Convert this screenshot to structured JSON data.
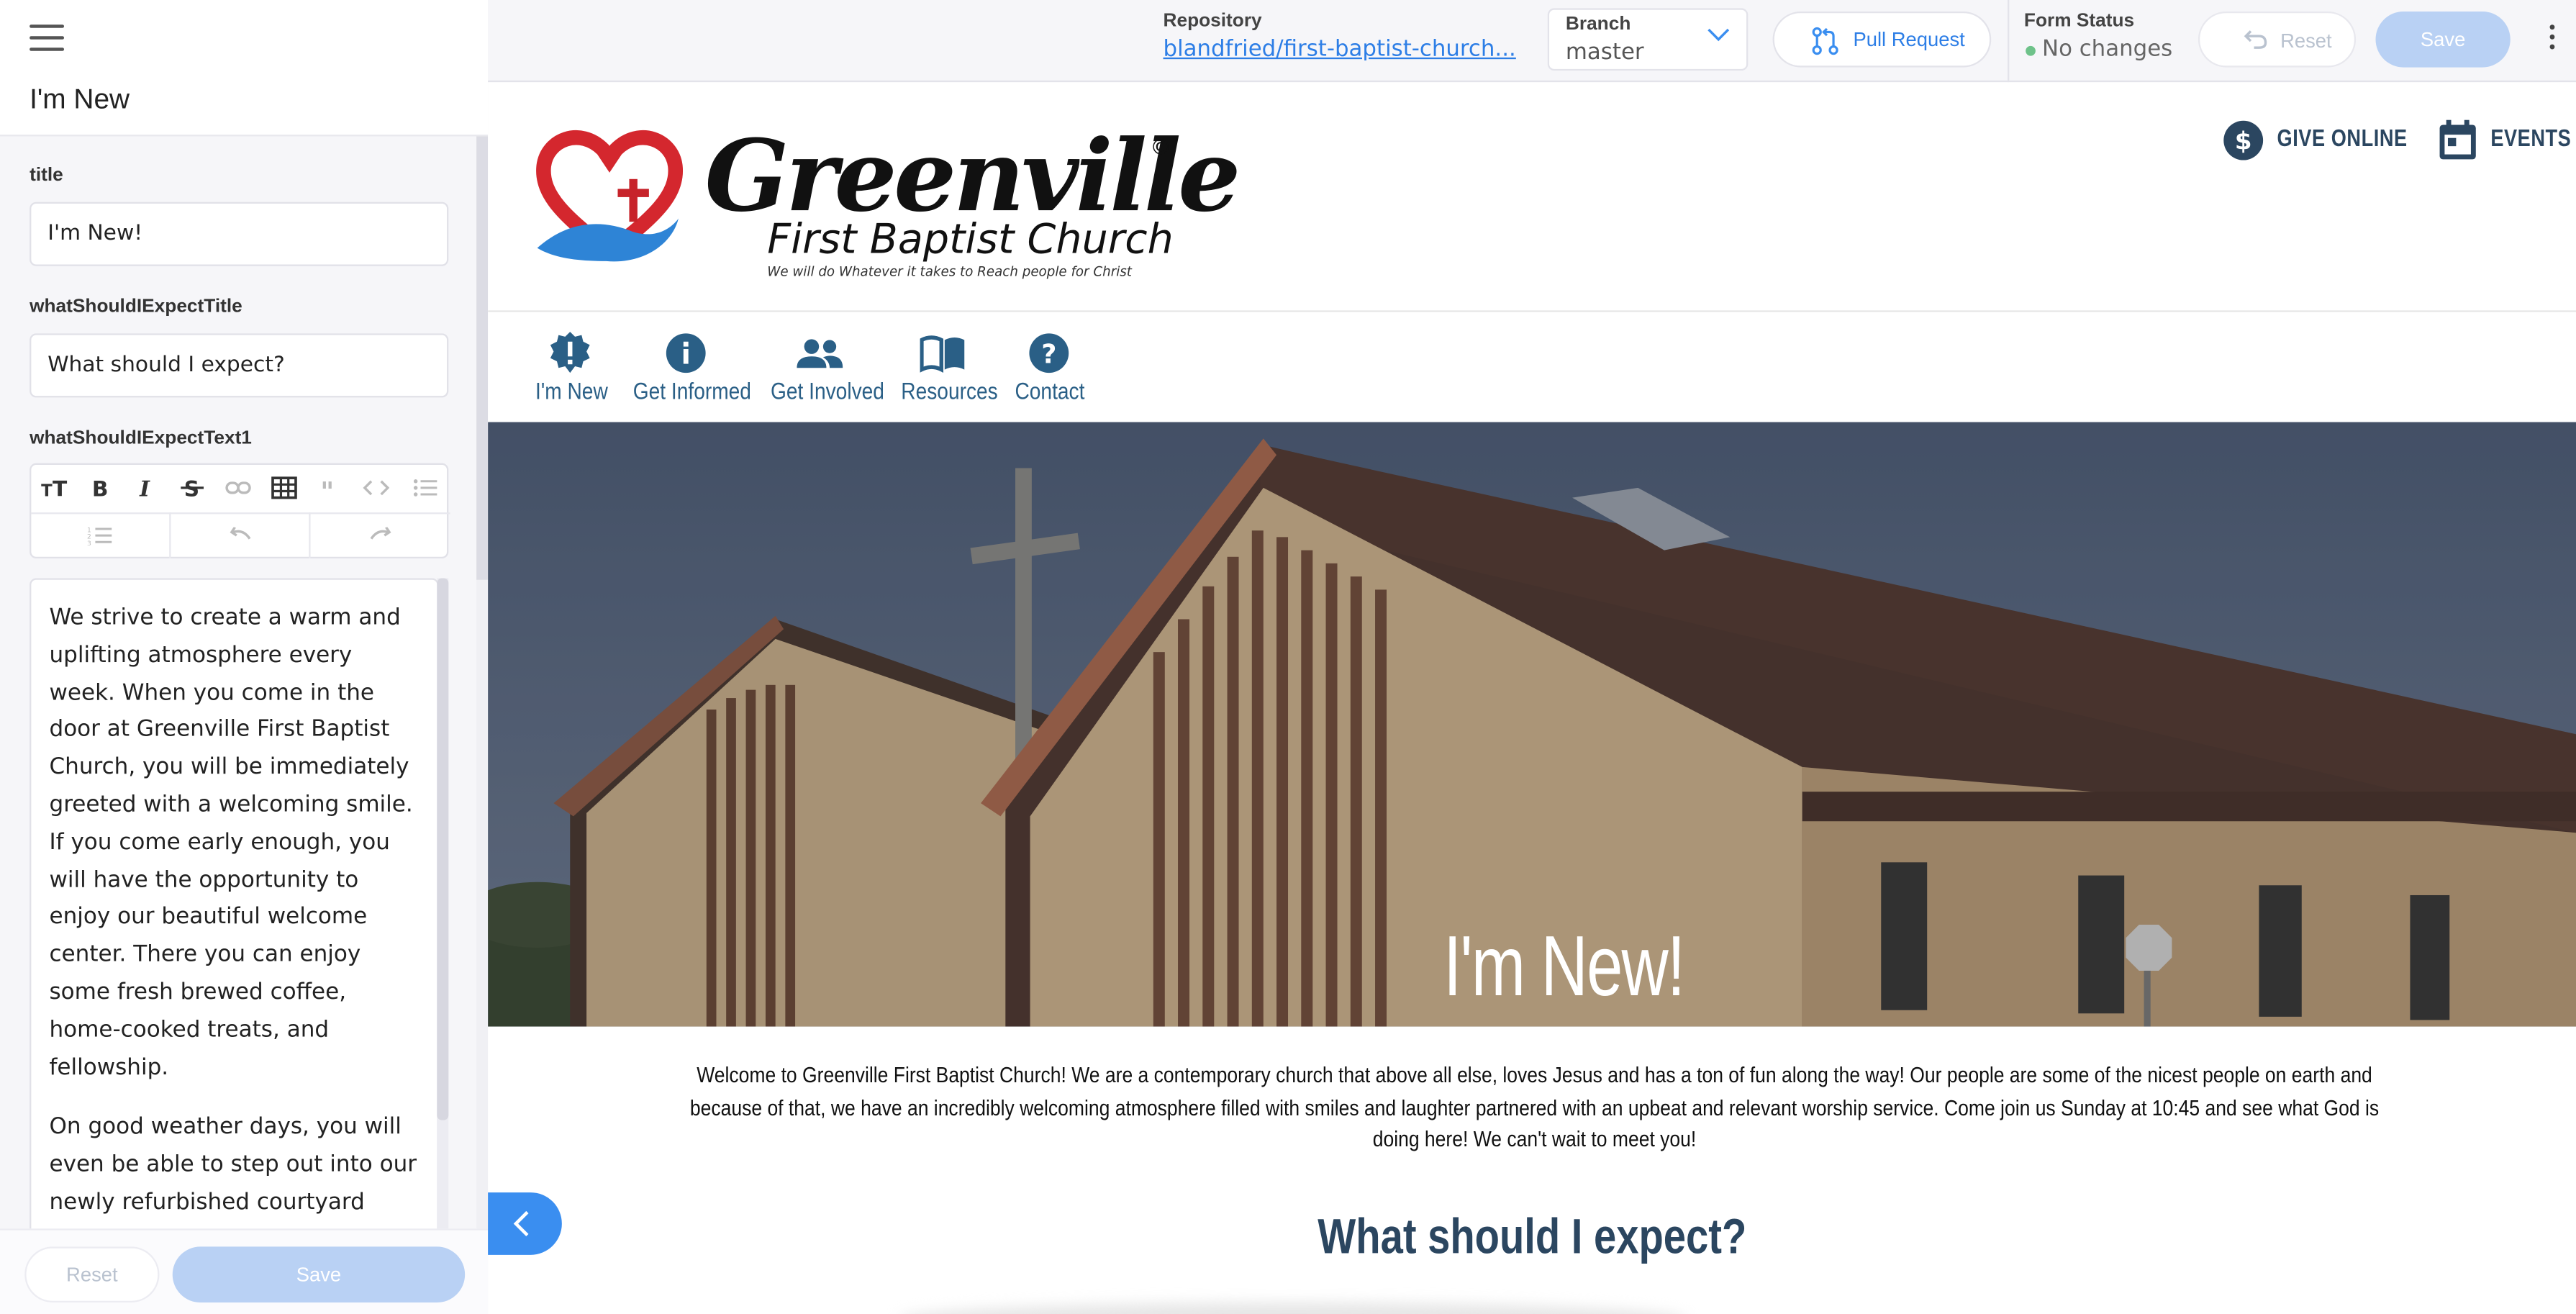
{
  "sidebar": {
    "title": "I'm New",
    "fields": {
      "title_label": "title",
      "title_value": "I'm New!",
      "expect_title_label": "whatShouldIExpectTitle",
      "expect_title_value": "What should I expect?",
      "expect_text_label": "whatShouldIExpectText1"
    },
    "editor_paragraphs": [
      "We strive to create a warm and uplifting atmosphere every week. When you come in the door at Greenville First Baptist Church, you will be immediately greeted with a welcoming smile. If you come early enough, you will have the opportunity to enjoy our beautiful welcome center. There you can enjoy some fresh brewed coffee, home-cooked treats, and fellowship.",
      "On good weather days, you will even be able to step out into our newly refurbished courtyard complete with tables and"
    ],
    "toolbar_icons": [
      "heading-icon",
      "bold-icon",
      "italic-icon",
      "strikethrough-icon",
      "link-icon",
      "table-icon",
      "quote-icon",
      "code-icon",
      "bullet-list-icon",
      "ordered-list-icon",
      "undo-icon",
      "redo-icon"
    ],
    "reset_label": "Reset",
    "save_label": "Save"
  },
  "topbar": {
    "repository_label": "Repository",
    "repository_value": "blandfried/first-baptist-church...",
    "branch_label": "Branch",
    "branch_value": "master",
    "pull_request_label": "Pull Request",
    "form_status_label": "Form Status",
    "form_status_value": "No changes",
    "reset_label": "Reset",
    "save_label": "Save"
  },
  "site": {
    "logo": {
      "name": "Greenville",
      "subtitle": "First Baptist Church",
      "tagline": "We will do Whatever it takes to Reach people for Christ",
      "copyright": "©"
    },
    "header_links": [
      {
        "label": "GIVE ONLINE",
        "icon": "dollar-circle-icon"
      },
      {
        "label": "EVENTS",
        "icon": "calendar-icon"
      }
    ],
    "nav": [
      {
        "label": "I'm New",
        "icon": "alert-badge-icon"
      },
      {
        "label": "Get Informed",
        "icon": "info-icon"
      },
      {
        "label": "Get Involved",
        "icon": "people-icon"
      },
      {
        "label": "Resources",
        "icon": "book-icon"
      },
      {
        "label": "Contact",
        "icon": "question-icon"
      }
    ],
    "hero_title": "I'm New!",
    "welcome_text": "Welcome to Greenville First Baptist Church! We are a contemporary church that above all else, loves Jesus and has a ton of fun along the way! Our people are some of the nicest people on earth and because of that, we have an incredibly welcoming atmosphere filled with smiles and laughter partnered with an upbeat and relevant worship service. Come join us Sunday at 10:45 and see what God is doing here! We can't wait to meet you!",
    "expect_heading": "What should I expect?"
  },
  "colors": {
    "accent_blue": "#3a8ef0",
    "link_blue": "#2d7ee6",
    "nav_blue": "#2a5f86",
    "heading_navy": "#2b4660",
    "save_disabled": "#b9d1f4",
    "status_green": "#6ec28a"
  }
}
